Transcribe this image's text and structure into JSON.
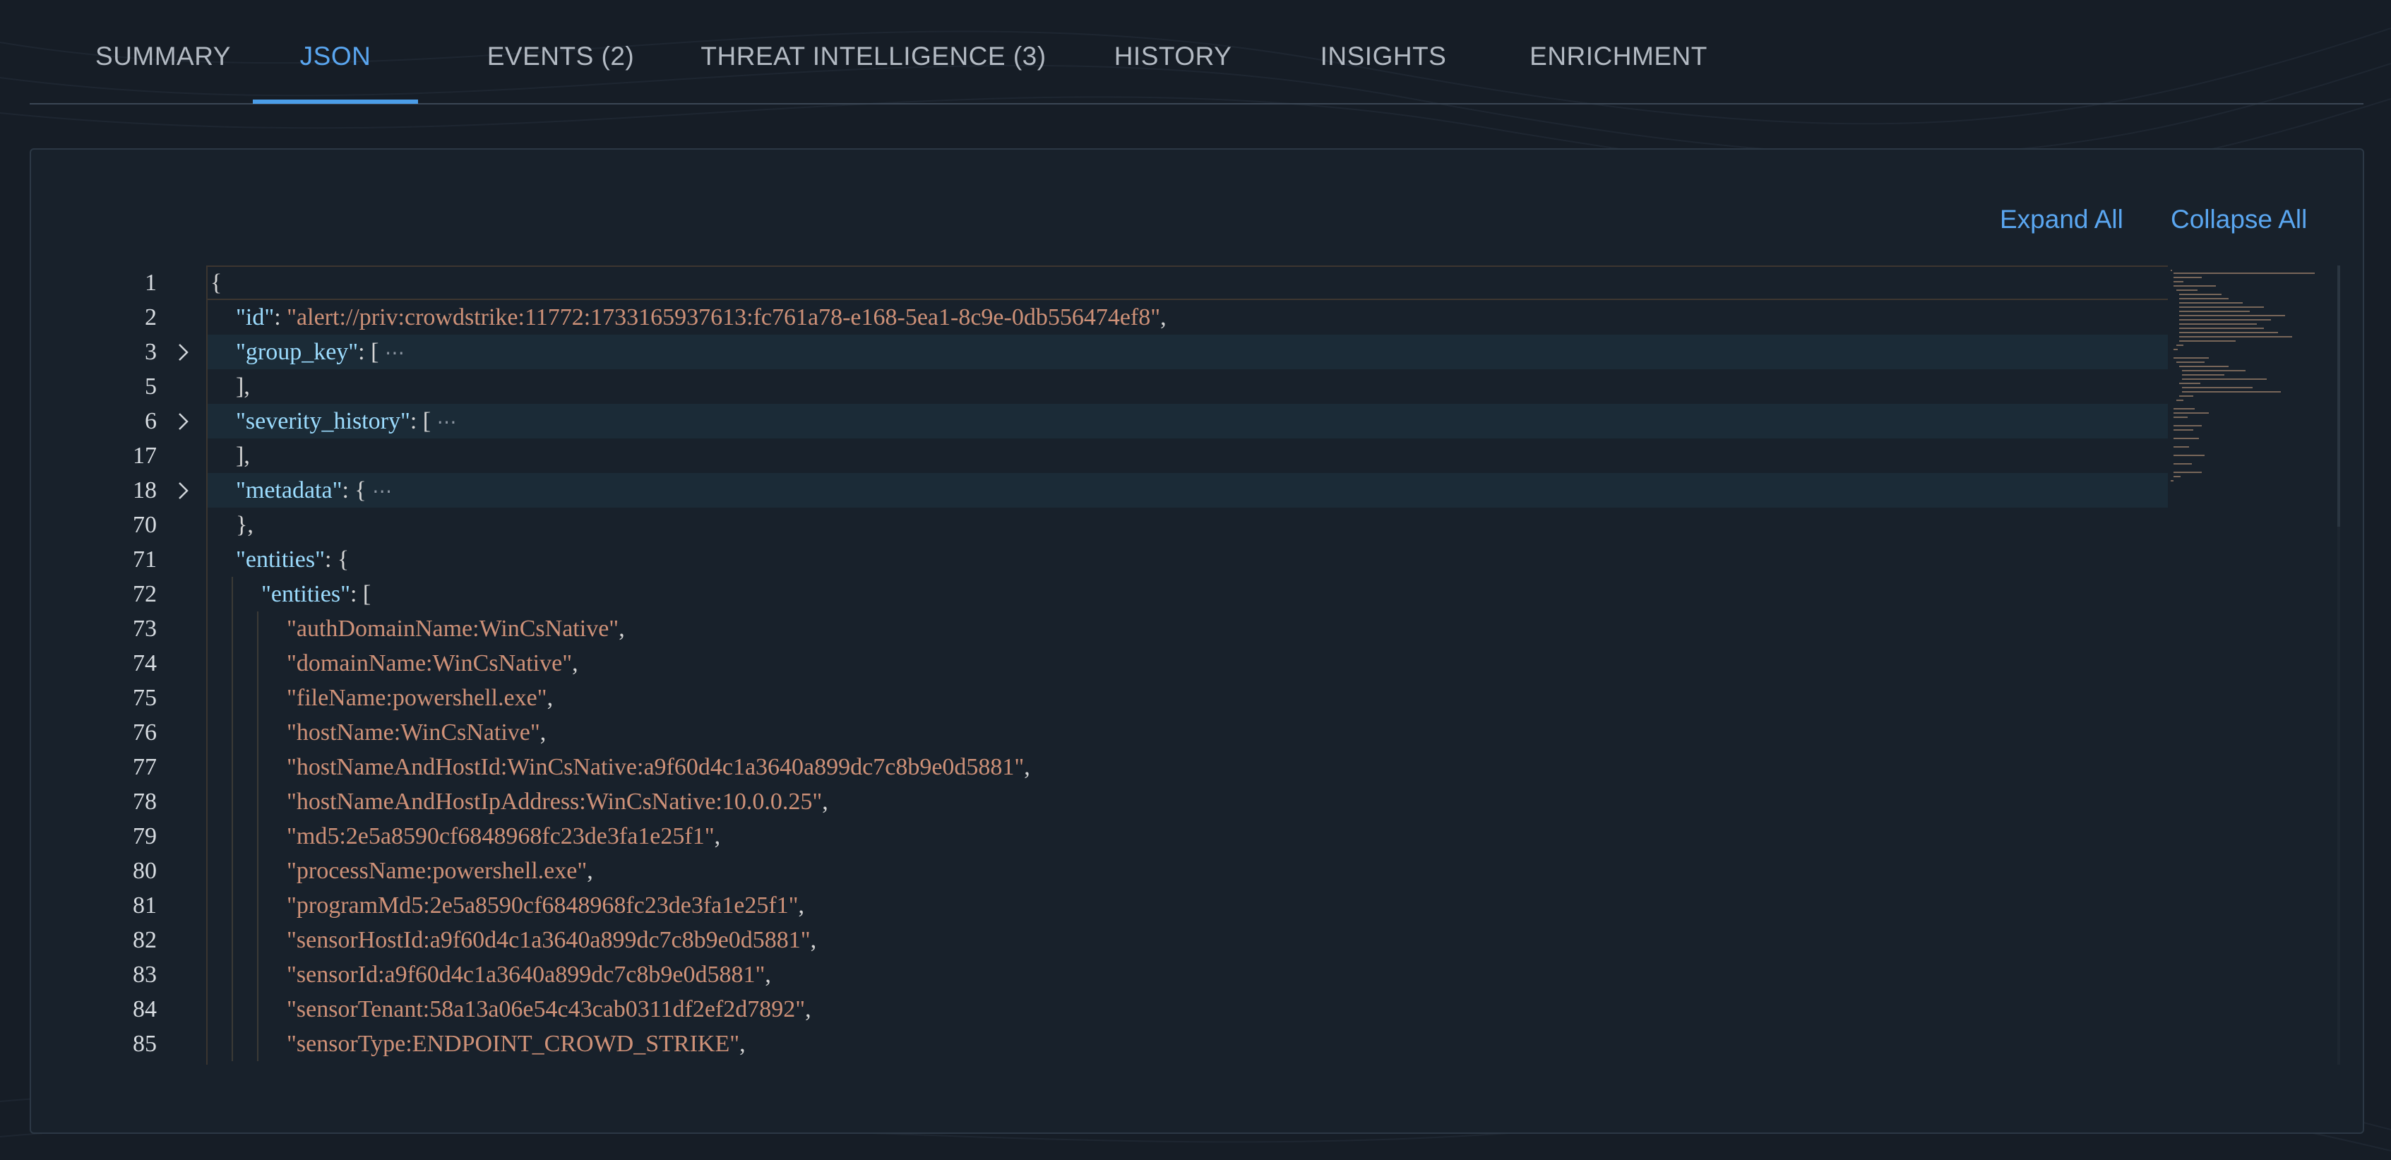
{
  "tabs": [
    {
      "label": "SUMMARY",
      "active": false
    },
    {
      "label": "JSON",
      "active": true
    },
    {
      "label": "EVENTS (2)",
      "active": false
    },
    {
      "label": "THREAT INTELLIGENCE (3)",
      "active": false
    },
    {
      "label": "HISTORY",
      "active": false
    },
    {
      "label": "INSIGHTS",
      "active": false
    },
    {
      "label": "ENRICHMENT",
      "active": false
    }
  ],
  "toolbar": {
    "expand_all": "Expand All",
    "collapse_all": "Collapse All"
  },
  "editor": {
    "lines": [
      {
        "num": "1",
        "indent": 0,
        "parts": [
          {
            "t": "pun",
            "v": "{"
          }
        ]
      },
      {
        "num": "2",
        "indent": 1,
        "parts": [
          {
            "t": "key",
            "v": "\"id\""
          },
          {
            "t": "pun",
            "v": ": "
          },
          {
            "t": "str",
            "v": "\"alert://priv:crowdstrike:11772:1733165937613:fc761a78-e168-5ea1-8c9e-0db556474ef8\""
          },
          {
            "t": "pun",
            "v": ","
          }
        ]
      },
      {
        "num": "3",
        "indent": 1,
        "folded": true,
        "parts": [
          {
            "t": "key",
            "v": "\"group_key\""
          },
          {
            "t": "pun",
            "v": ": [ "
          },
          {
            "t": "ell",
            "v": "⋯"
          }
        ]
      },
      {
        "num": "5",
        "indent": 1,
        "parts": [
          {
            "t": "pun",
            "v": "],"
          }
        ]
      },
      {
        "num": "6",
        "indent": 1,
        "folded": true,
        "parts": [
          {
            "t": "key",
            "v": "\"severity_history\""
          },
          {
            "t": "pun",
            "v": ": [ "
          },
          {
            "t": "ell",
            "v": "⋯"
          }
        ]
      },
      {
        "num": "17",
        "indent": 1,
        "parts": [
          {
            "t": "pun",
            "v": "],"
          }
        ]
      },
      {
        "num": "18",
        "indent": 1,
        "folded": true,
        "parts": [
          {
            "t": "key",
            "v": "\"metadata\""
          },
          {
            "t": "pun",
            "v": ": { "
          },
          {
            "t": "ell",
            "v": "⋯"
          }
        ]
      },
      {
        "num": "70",
        "indent": 1,
        "parts": [
          {
            "t": "pun",
            "v": "},"
          }
        ]
      },
      {
        "num": "71",
        "indent": 1,
        "parts": [
          {
            "t": "key",
            "v": "\"entities\""
          },
          {
            "t": "pun",
            "v": ": {"
          }
        ]
      },
      {
        "num": "72",
        "indent": 2,
        "parts": [
          {
            "t": "key",
            "v": "\"entities\""
          },
          {
            "t": "pun",
            "v": ": ["
          }
        ]
      },
      {
        "num": "73",
        "indent": 3,
        "parts": [
          {
            "t": "str",
            "v": "\"authDomainName:WinCsNative\""
          },
          {
            "t": "pun",
            "v": ","
          }
        ]
      },
      {
        "num": "74",
        "indent": 3,
        "parts": [
          {
            "t": "str",
            "v": "\"domainName:WinCsNative\""
          },
          {
            "t": "pun",
            "v": ","
          }
        ]
      },
      {
        "num": "75",
        "indent": 3,
        "parts": [
          {
            "t": "str",
            "v": "\"fileName:powershell.exe\""
          },
          {
            "t": "pun",
            "v": ","
          }
        ]
      },
      {
        "num": "76",
        "indent": 3,
        "parts": [
          {
            "t": "str",
            "v": "\"hostName:WinCsNative\""
          },
          {
            "t": "pun",
            "v": ","
          }
        ]
      },
      {
        "num": "77",
        "indent": 3,
        "parts": [
          {
            "t": "str",
            "v": "\"hostNameAndHostId:WinCsNative:a9f60d4c1a3640a899dc7c8b9e0d5881\""
          },
          {
            "t": "pun",
            "v": ","
          }
        ]
      },
      {
        "num": "78",
        "indent": 3,
        "parts": [
          {
            "t": "str",
            "v": "\"hostNameAndHostIpAddress:WinCsNative:10.0.0.25\""
          },
          {
            "t": "pun",
            "v": ","
          }
        ]
      },
      {
        "num": "79",
        "indent": 3,
        "parts": [
          {
            "t": "str",
            "v": "\"md5:2e5a8590cf6848968fc23de3fa1e25f1\""
          },
          {
            "t": "pun",
            "v": ","
          }
        ]
      },
      {
        "num": "80",
        "indent": 3,
        "parts": [
          {
            "t": "str",
            "v": "\"processName:powershell.exe\""
          },
          {
            "t": "pun",
            "v": ","
          }
        ]
      },
      {
        "num": "81",
        "indent": 3,
        "parts": [
          {
            "t": "str",
            "v": "\"programMd5:2e5a8590cf6848968fc23de3fa1e25f1\""
          },
          {
            "t": "pun",
            "v": ","
          }
        ]
      },
      {
        "num": "82",
        "indent": 3,
        "parts": [
          {
            "t": "str",
            "v": "\"sensorHostId:a9f60d4c1a3640a899dc7c8b9e0d5881\""
          },
          {
            "t": "pun",
            "v": ","
          }
        ]
      },
      {
        "num": "83",
        "indent": 3,
        "parts": [
          {
            "t": "str",
            "v": "\"sensorId:a9f60d4c1a3640a899dc7c8b9e0d5881\""
          },
          {
            "t": "pun",
            "v": ","
          }
        ]
      },
      {
        "num": "84",
        "indent": 3,
        "parts": [
          {
            "t": "str",
            "v": "\"sensorTenant:58a13a06e54c43cab0311df2ef2d7892\""
          },
          {
            "t": "pun",
            "v": ","
          }
        ]
      },
      {
        "num": "85",
        "indent": 3,
        "parts": [
          {
            "t": "str",
            "v": "\"sensorType:ENDPOINT_CROWD_STRIKE\""
          },
          {
            "t": "pun",
            "v": ","
          }
        ]
      }
    ]
  },
  "colors": {
    "background": "#161d26",
    "panel": "#18212b",
    "accent": "#4b9de8",
    "json_key": "#9cdcfe",
    "json_string": "#ce9178"
  },
  "icons": {
    "fold": "chevron-right-icon"
  }
}
